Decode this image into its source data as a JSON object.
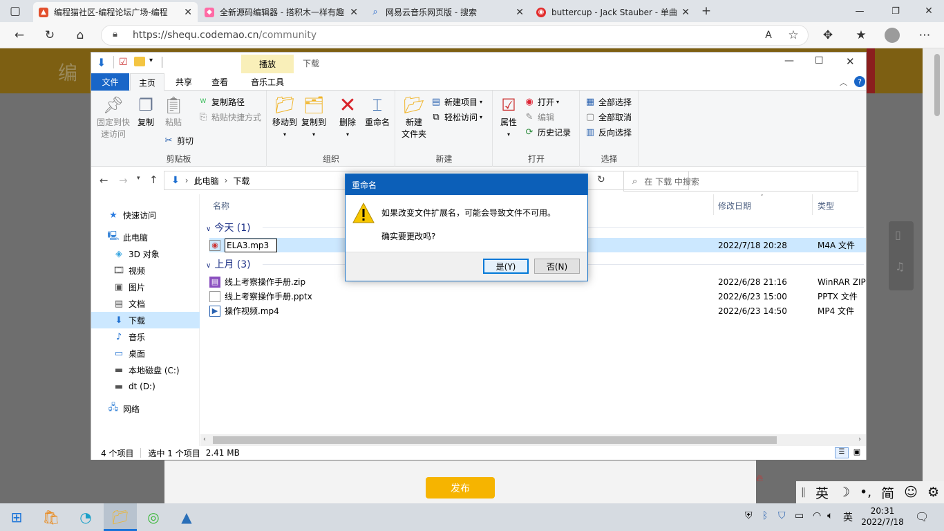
{
  "browser": {
    "tabs": [
      {
        "title": "编程猫社区-编程论坛广场-编程",
        "icon": "codemao-icon",
        "active": true
      },
      {
        "title": "全新源码编辑器 - 搭积木一样有趣",
        "icon": "kitten-icon",
        "active": false
      },
      {
        "title": "网易云音乐网页版 - 搜索",
        "icon": "search-icon",
        "active": false
      },
      {
        "title": "buttercup - Jack Stauber - 单曲 -",
        "icon": "netease-icon",
        "active": false
      }
    ],
    "url_host": "https://shequ.codemao.cn",
    "url_path": "/community"
  },
  "page": {
    "publish_label": "发布",
    "ime": [
      "英",
      "☽",
      "•,",
      "简",
      "☺",
      "⚙"
    ]
  },
  "explorer": {
    "title": "下载",
    "context_tab": "播放",
    "ribbon_tabs": [
      "文件",
      "主页",
      "共享",
      "查看",
      "音乐工具"
    ],
    "clipboard": {
      "pin": "固定到快速访问",
      "copy": "复制",
      "paste": "粘贴",
      "copy_path": "复制路径",
      "paste_shortcut": "粘贴快捷方式",
      "cut": "剪切",
      "label": "剪贴板"
    },
    "organize": {
      "move_to": "移动到",
      "copy_to": "复制到",
      "delete": "删除",
      "rename": "重命名",
      "label": "组织"
    },
    "new": {
      "new_folder": "新建\n文件夹",
      "new_item": "新建项目",
      "easy_access": "轻松访问",
      "label": "新建"
    },
    "open": {
      "properties": "属性",
      "open": "打开",
      "edit": "编辑",
      "history": "历史记录",
      "label": "打开"
    },
    "select": {
      "select_all": "全部选择",
      "select_none": "全部取消",
      "invert": "反向选择",
      "label": "选择"
    },
    "breadcrumb": [
      "此电脑",
      "下载"
    ],
    "search_placeholder": "在 下载 中搜索",
    "sidebar": [
      {
        "label": "快速访问",
        "icon": "star-icon"
      },
      {
        "label": "此电脑",
        "icon": "computer-icon"
      },
      {
        "label": "3D 对象",
        "icon": "cube-icon"
      },
      {
        "label": "视频",
        "icon": "video-icon"
      },
      {
        "label": "图片",
        "icon": "picture-icon"
      },
      {
        "label": "文档",
        "icon": "document-icon"
      },
      {
        "label": "下载",
        "icon": "download-icon"
      },
      {
        "label": "音乐",
        "icon": "music-icon"
      },
      {
        "label": "桌面",
        "icon": "desktop-icon"
      },
      {
        "label": "本地磁盘 (C:)",
        "icon": "drive-icon"
      },
      {
        "label": "dt (D:)",
        "icon": "drive-icon"
      },
      {
        "label": "网络",
        "icon": "network-icon"
      }
    ],
    "columns": {
      "name": "名称",
      "date": "修改日期",
      "type": "类型"
    },
    "groups": [
      {
        "label": "今天 (1)",
        "files": [
          {
            "name": "ELA3.mp3",
            "date": "2022/7/18 20:28",
            "type": "M4A 文件",
            "icon": "audio-file-icon",
            "editing": true
          }
        ]
      },
      {
        "label": "上月 (3)",
        "files": [
          {
            "name": "线上考察操作手册.zip",
            "date": "2022/6/28 21:16",
            "type": "WinRAR ZIP",
            "icon": "zip-file-icon"
          },
          {
            "name": "线上考察操作手册.pptx",
            "date": "2022/6/23 15:00",
            "type": "PPTX 文件",
            "icon": "blank-file-icon"
          },
          {
            "name": "操作视频.mp4",
            "date": "2022/6/23 14:50",
            "type": "MP4 文件",
            "icon": "video-file-icon"
          }
        ]
      }
    ],
    "status": {
      "count": "4 个项目",
      "selected": "选中 1 个项目",
      "size": "2.41 MB"
    }
  },
  "dialog": {
    "title": "重命名",
    "message": "如果改变文件扩展名，可能会导致文件不可用。",
    "question": "确实要更改吗?",
    "yes": "是(Y)",
    "no": "否(N)"
  },
  "taskbar": {
    "time": "20:31",
    "date": "2022/7/18",
    "lang": "英"
  },
  "colors": {
    "accent": "#0c5fb8",
    "selection": "#cce8ff",
    "publish": "#f6b400"
  }
}
